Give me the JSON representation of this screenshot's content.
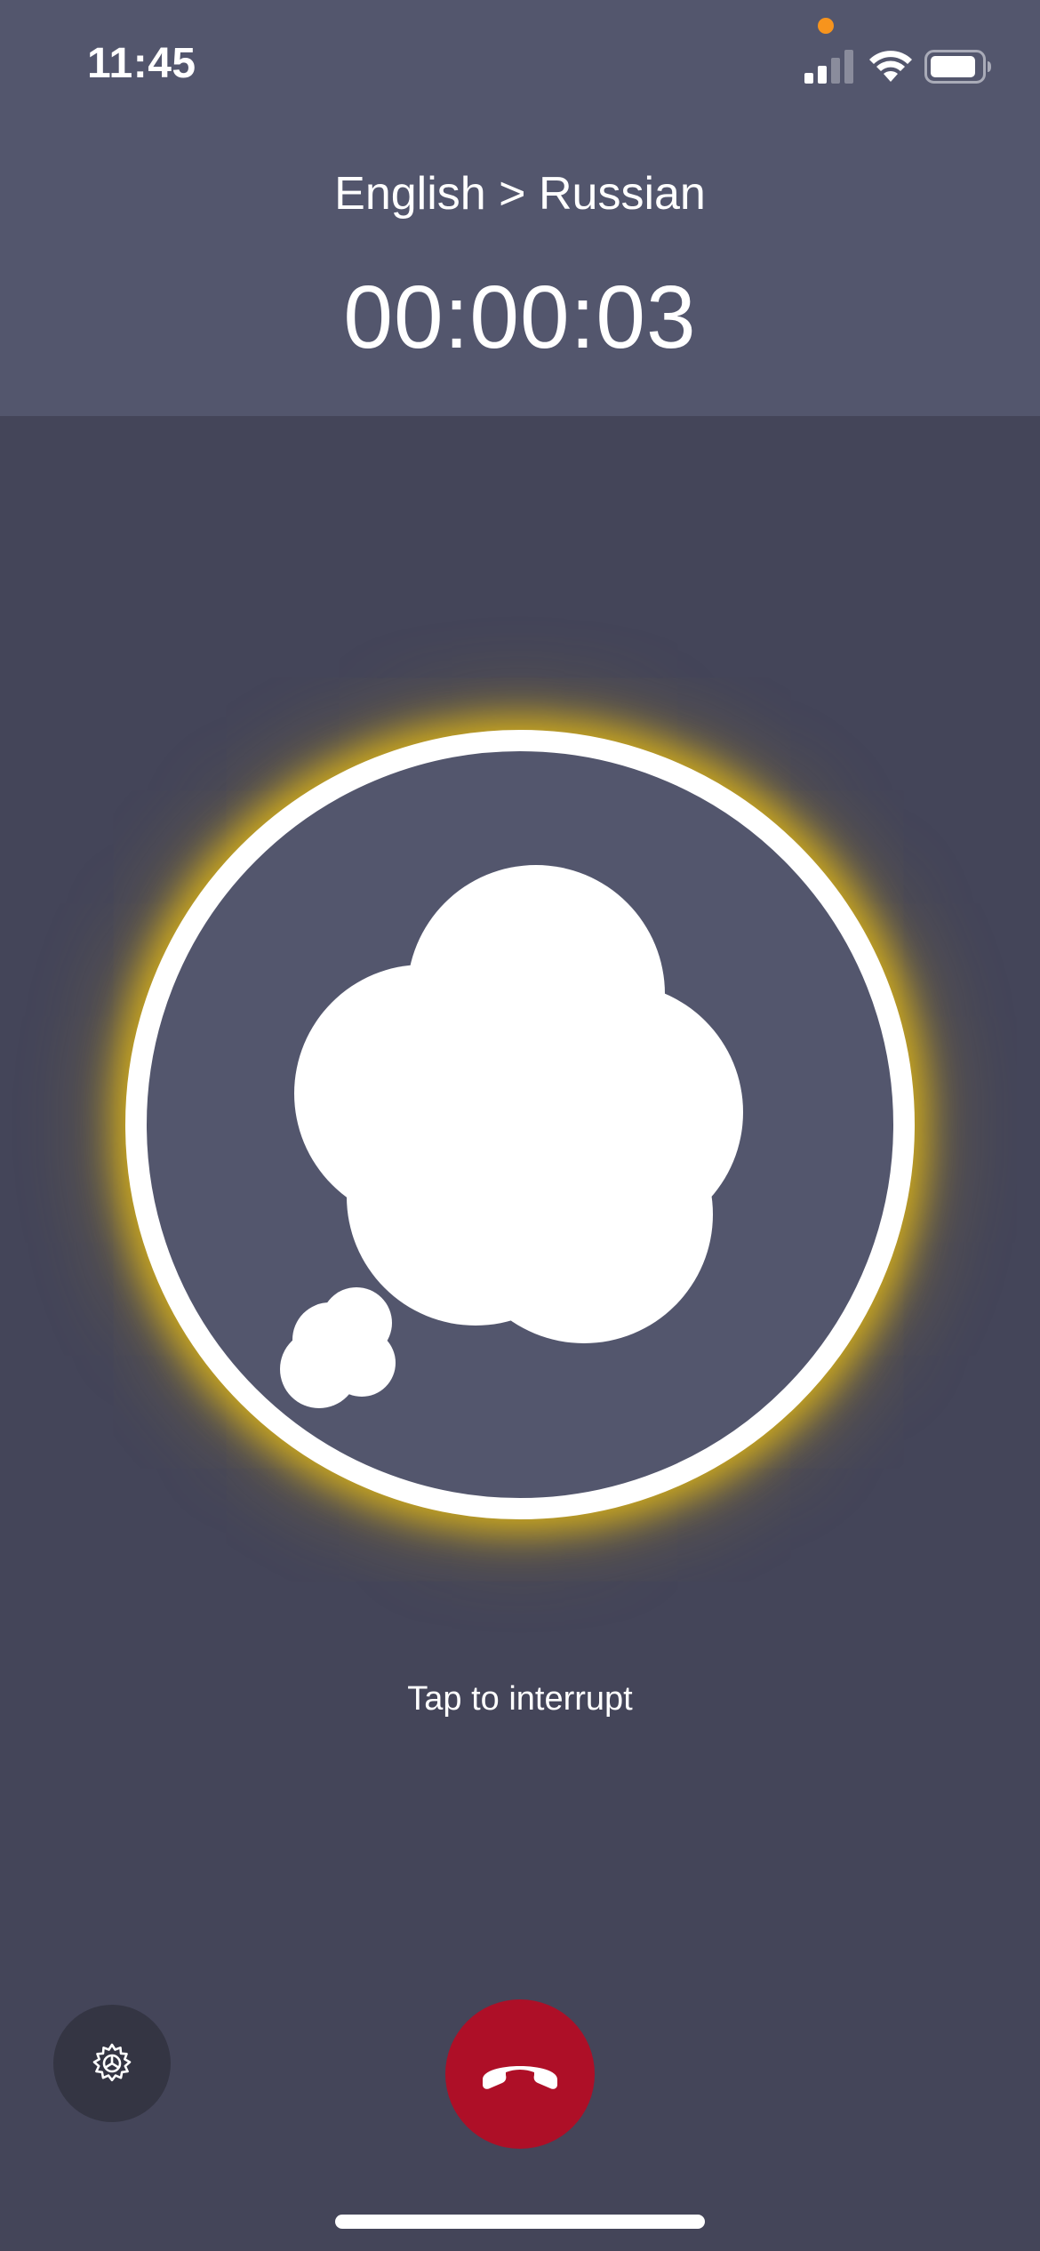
{
  "status_bar": {
    "time": "11:45"
  },
  "call": {
    "language_pair": "English > Russian",
    "timer": "00:00:03",
    "hint": "Tap to interrupt"
  },
  "icons": {
    "center": "thought-bubble-icon",
    "settings": "gear-icon",
    "end_call": "phone-hangup-icon"
  },
  "colors": {
    "header_bg": "#53566d",
    "body_bg": "#444559",
    "glow": "#e2b816",
    "end_call": "#ae0f27",
    "privacy_indicator": "#f7941d"
  }
}
